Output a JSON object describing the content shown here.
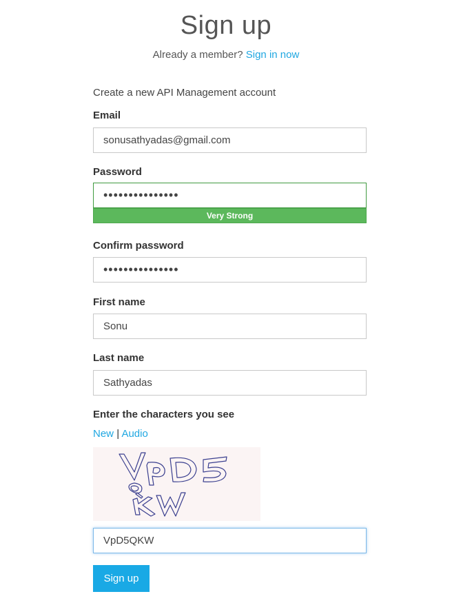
{
  "header": {
    "title": "Sign up",
    "member_prompt": "Already a member?",
    "signin_link": "Sign in now"
  },
  "form": {
    "subtitle": "Create a new API Management account",
    "email": {
      "label": "Email",
      "value": "sonusathyadas@gmail.com"
    },
    "password": {
      "label": "Password",
      "value": "•••••••••••••••",
      "strength": "Very Strong"
    },
    "confirm_password": {
      "label": "Confirm password",
      "value": "•••••••••••••••"
    },
    "first_name": {
      "label": "First name",
      "value": "Sonu"
    },
    "last_name": {
      "label": "Last name",
      "value": "Sathyadas"
    },
    "captcha": {
      "label": "Enter the characters you see",
      "new_link": "New",
      "separator": "|",
      "audio_link": "Audio",
      "image_text": "VpD5QKW",
      "value": "VpD5QKW"
    },
    "submit_label": "Sign up"
  },
  "colors": {
    "accent": "#1fa7e1",
    "button": "#19a9e5",
    "strength_bar": "#5cb85c"
  }
}
